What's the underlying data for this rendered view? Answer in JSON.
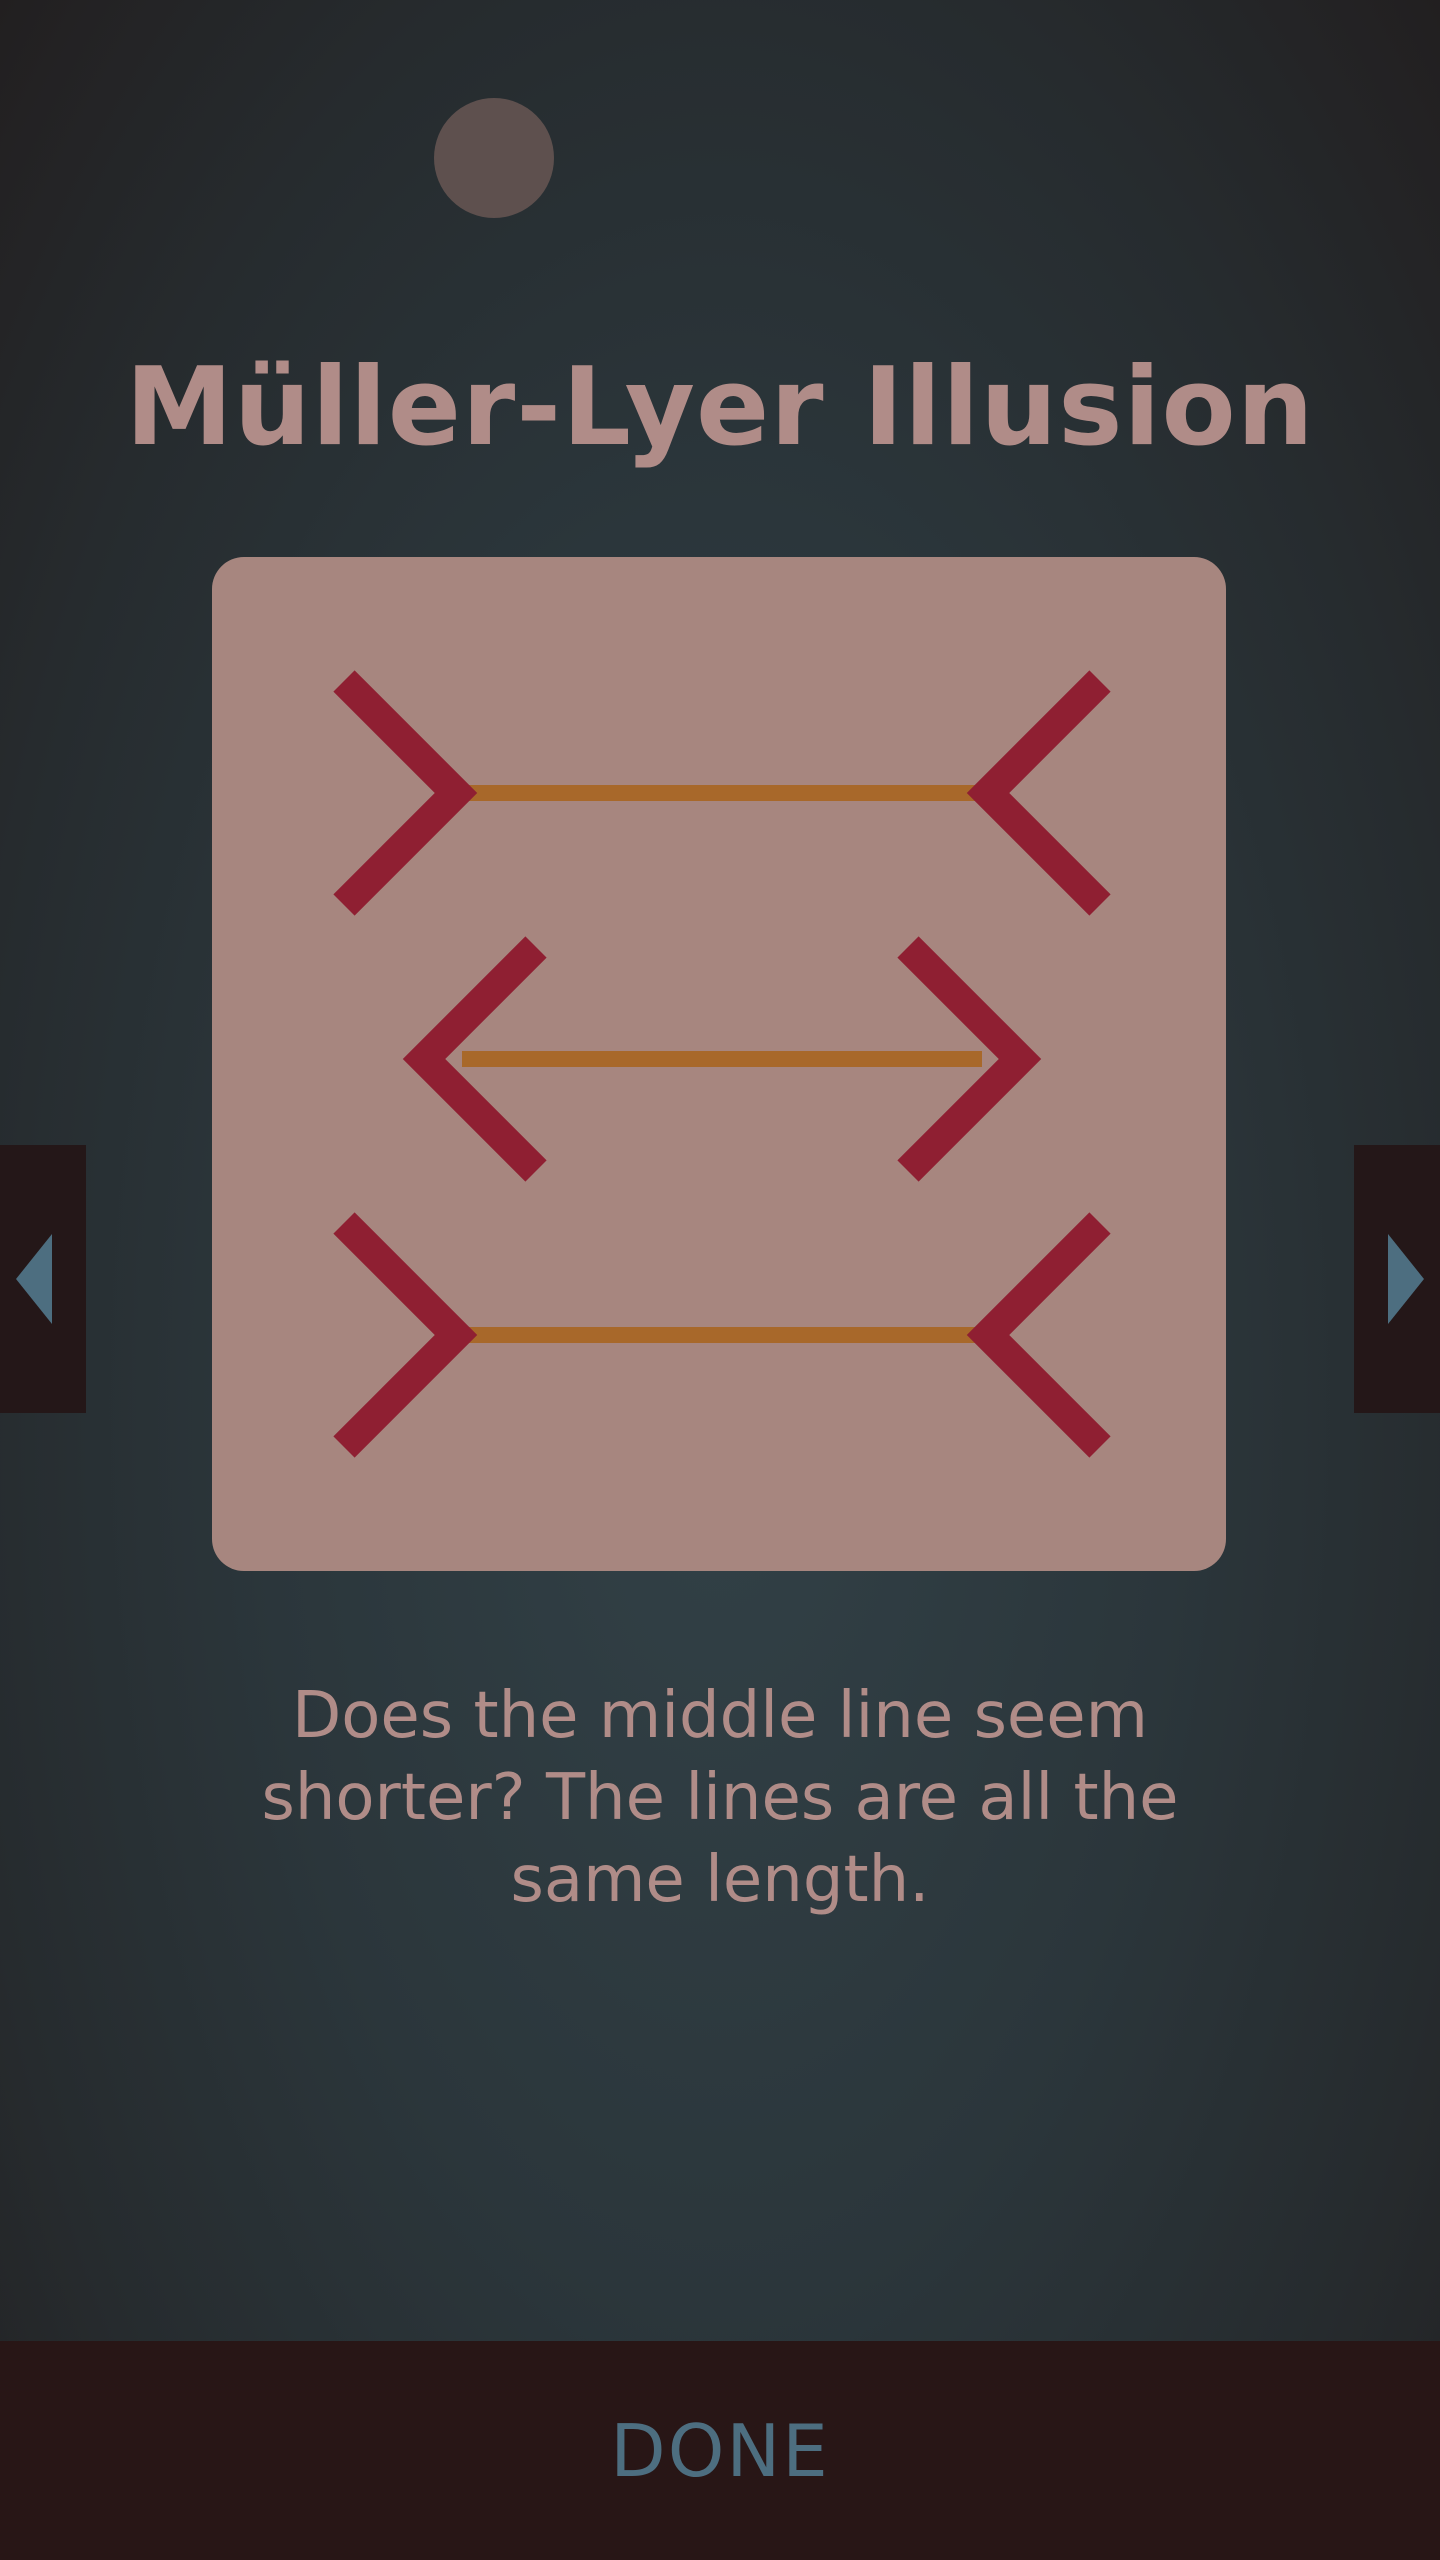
{
  "screen": {
    "title": "Müller-Lyer Illusion",
    "description": "Does the middle line seem shorter? The lines are all the same length."
  },
  "illustration": {
    "shaft_color": "#a8682a",
    "arrowhead_color": "#8f1f32",
    "background_color": "#a7867f",
    "rows": [
      {
        "name": "top-line",
        "fins": "outward"
      },
      {
        "name": "middle-line",
        "fins": "inward"
      },
      {
        "name": "bottom-line",
        "fins": "outward"
      }
    ]
  },
  "navigation": {
    "prev_icon": "triangle-left-icon",
    "next_icon": "triangle-right-icon",
    "arrow_color": "#4d6e80"
  },
  "footer": {
    "done_label": "DONE"
  }
}
